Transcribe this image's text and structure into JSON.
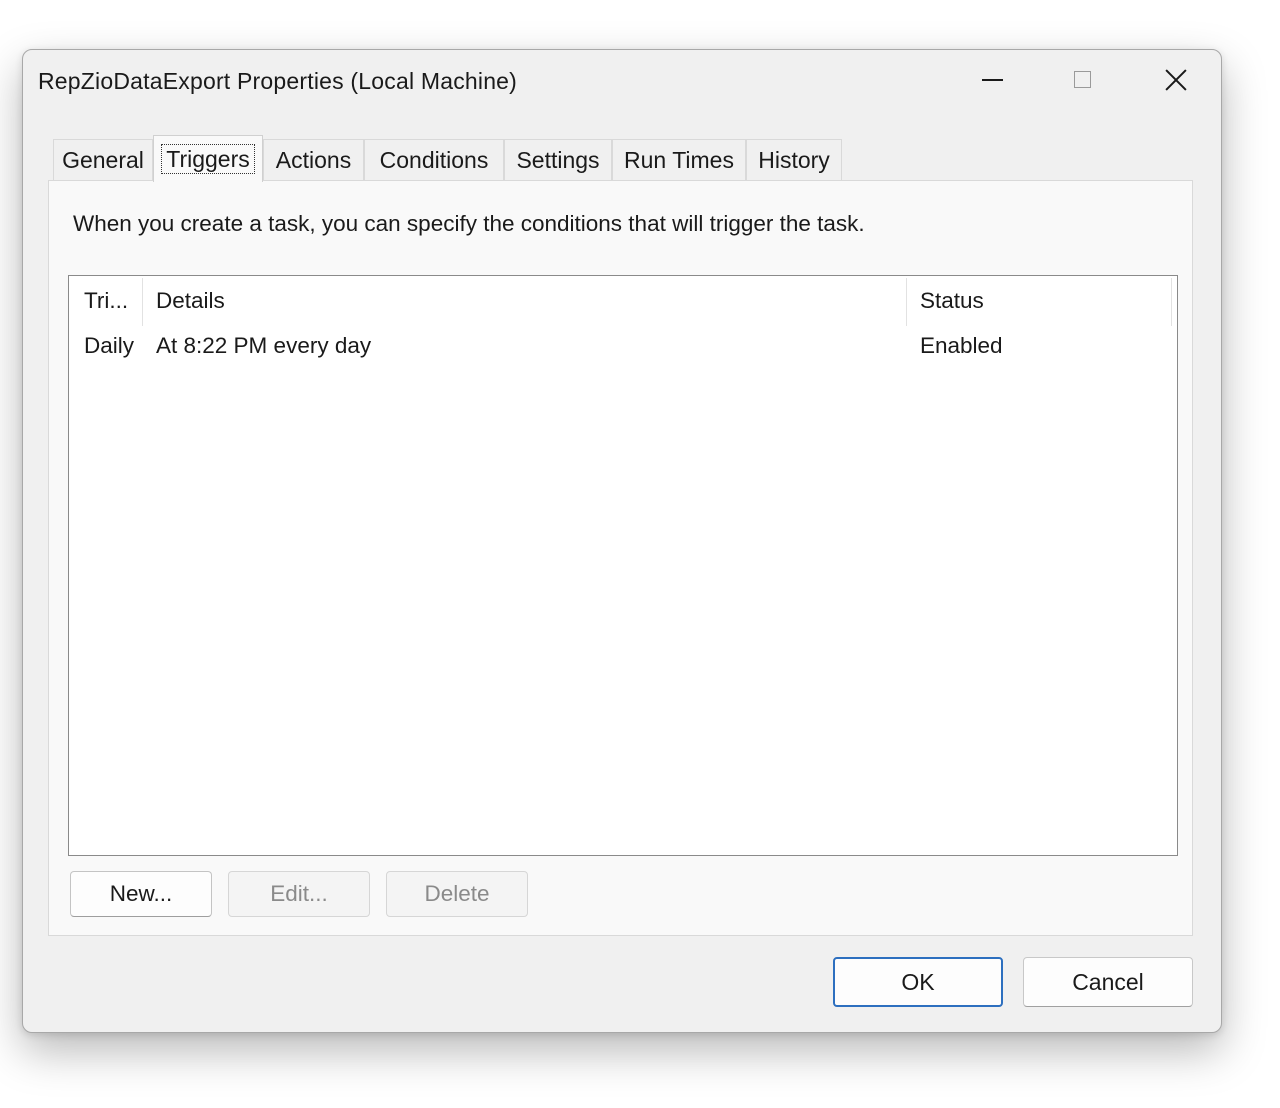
{
  "window": {
    "title": "RepZioDataExport Properties (Local Machine)"
  },
  "tabs": [
    {
      "label": "General"
    },
    {
      "label": "Triggers",
      "active": true
    },
    {
      "label": "Actions"
    },
    {
      "label": "Conditions"
    },
    {
      "label": "Settings"
    },
    {
      "label": "Run Times"
    },
    {
      "label": "History"
    }
  ],
  "triggers_panel": {
    "description": "When you create a task, you can specify the conditions that will trigger the task.",
    "columns": [
      "Tri...",
      "Details",
      "Status"
    ],
    "rows": [
      {
        "trigger": "Daily",
        "details": "At 8:22 PM every day",
        "status": "Enabled"
      }
    ],
    "buttons": {
      "new": "New...",
      "edit": "Edit...",
      "delete": "Delete"
    }
  },
  "dialog_buttons": {
    "ok": "OK",
    "cancel": "Cancel"
  },
  "colors": {
    "default_button_border": "#2d6fbf",
    "window_background": "#f0f0f0",
    "panel_background": "#f9f9f9"
  }
}
